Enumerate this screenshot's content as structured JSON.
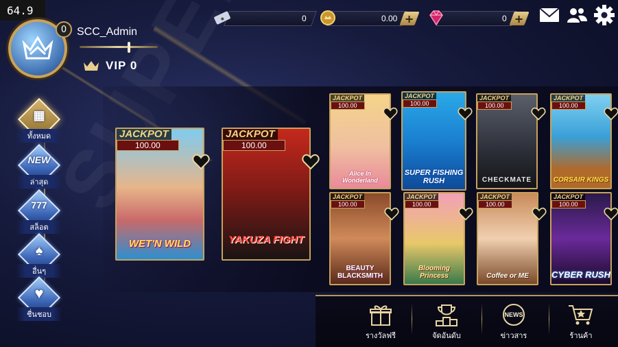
{
  "fps": "64.9",
  "user": {
    "level": "0",
    "name": "SCC_Admin",
    "vip": "VIP 0",
    "xp_fraction": 0.62
  },
  "currencies": [
    {
      "icon": "ticket-icon",
      "value": "0",
      "has_plus": false
    },
    {
      "icon": "coin-icon",
      "value": "0.00",
      "has_plus": true
    },
    {
      "icon": "gem-icon",
      "value": "0",
      "has_plus": true
    }
  ],
  "top_icons": [
    "mail-icon",
    "friends-icon",
    "settings-icon"
  ],
  "bg_watermark": "SUPER",
  "nav": [
    {
      "id": "all",
      "glyph": "▦",
      "label": "ทั้งหมด",
      "active": true
    },
    {
      "id": "new",
      "glyph": "NEW",
      "label": "ล่าสุด",
      "active": false
    },
    {
      "id": "slot",
      "glyph": "777",
      "label": "สล็อต",
      "active": false
    },
    {
      "id": "other",
      "glyph": "♠",
      "label": "อื่นๆ",
      "active": false
    },
    {
      "id": "fav",
      "glyph": "♥",
      "label": "ชื่นชอบ",
      "active": false
    }
  ],
  "featured_games": [
    {
      "id": "wet-n-wild",
      "jackpot_label": "JACKPOT",
      "jackpot_amount": "100.00",
      "logo": "WET'N WILD"
    },
    {
      "id": "yakuza-fight",
      "jackpot_label": "JACKPOT",
      "jackpot_amount": "100.00",
      "logo": "YAKUZA FIGHT"
    }
  ],
  "games": [
    {
      "id": "alice",
      "jackpot_label": "JACKPOT",
      "jackpot_amount": "100.00",
      "logo": "Alice In Wonderland"
    },
    {
      "id": "super-fishing",
      "jackpot_label": "JACKPOT",
      "jackpot_amount": "100.00",
      "logo": "SUPER FISHING RUSH"
    },
    {
      "id": "checkmate",
      "jackpot_label": "JACKPOT",
      "jackpot_amount": "100.00",
      "logo": "CHECKMATE"
    },
    {
      "id": "corsair-kings",
      "jackpot_label": "JACKPOT",
      "jackpot_amount": "100.00",
      "logo": "CORSAIR KINGS"
    },
    {
      "id": "beauty-blacksmith",
      "jackpot_label": "JACKPOT",
      "jackpot_amount": "100.00",
      "logo": "BEAUTY BLACKSMITH"
    },
    {
      "id": "blooming-princess",
      "jackpot_label": "JACKPOT",
      "jackpot_amount": "100.00",
      "logo": "Blooming Princess"
    },
    {
      "id": "coffee-or-me",
      "jackpot_label": "JACKPOT",
      "jackpot_amount": "100.00",
      "logo": "Coffee or ME"
    },
    {
      "id": "cyber-rush",
      "jackpot_label": "JACKPOT",
      "jackpot_amount": "100.00",
      "logo": "CYBER RUSH"
    }
  ],
  "bottom_tabs": [
    {
      "id": "rewards",
      "icon": "gift-icon",
      "label": "รางวัลฟรี"
    },
    {
      "id": "ranking",
      "icon": "trophy-icon",
      "label": "จัดอันดับ"
    },
    {
      "id": "news",
      "icon": "news-icon",
      "label": "ข่าวสาร",
      "icon_text": "NEWS"
    },
    {
      "id": "shop",
      "icon": "cart-icon",
      "label": "ร้านค้า"
    }
  ],
  "colors": {
    "gold": "#c9a25a",
    "jackpot_red": "#6b1010",
    "nav_blue": "#3a64b5"
  }
}
